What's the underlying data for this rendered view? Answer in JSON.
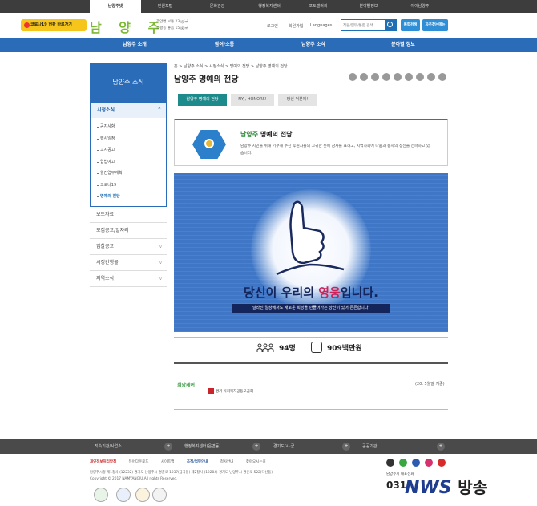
{
  "topbar": {
    "tabs": [
      "남양주넷",
      "민원포털",
      "문화관광",
      "행정복지센터",
      "포토갤러리",
      "분야별정보",
      "아이남양주"
    ]
  },
  "header": {
    "covid_label": "코로나19 현황 바로가기",
    "logo": "남 양 주",
    "weather_line1": "조안면 보통 23㎍/㎥",
    "weather_line2": "호평동 좋음 15㎍/㎥",
    "login": "로그인",
    "join": "회원가입",
    "languages": "Languages",
    "search_placeholder": "직원/업무/통합 검색",
    "btn_integrated": "통합검색",
    "btn_faq": "자주찾는메뉴"
  },
  "gnb": [
    "남양주 소개",
    "참여/소통",
    "남양주 소식",
    "분야별 정보"
  ],
  "lnb": {
    "head": "남양주 소식",
    "group_title": "시정소식",
    "sub_items": [
      "공지사항",
      "행사일정",
      "고시공고",
      "입법예고",
      "월간업무계획",
      "코로나19",
      "명예의 전당"
    ],
    "rows": [
      "보도자료",
      "모집공고/일자리",
      "입찰공고",
      "시정간행물",
      "지역소식"
    ]
  },
  "breadcrumb": "홈 > 남양주 소식 > 시정소식 > 명예의 전당 > 남양주 명예의 전당",
  "page_title": "남양주 명예의 전당",
  "tabs": [
    "남양주 명예의 전당",
    "NYJ, HONORS!",
    "당신 덕분에!"
  ],
  "info": {
    "title_accent": "남양주",
    "title_rest": " 명예의 전당",
    "text": "남양주 시민을 위해 기부해 주신 후원자들의 고귀한 뜻에 감사를 표하고, 지역사회에 나눔과 봉사의 정신을 전파하고 있습니다."
  },
  "banner": {
    "headline_a": "당신이 우리의 ",
    "headline_b": "영웅",
    "headline_c": "입니다.",
    "sub": "달라진 일상에서도 새로운 희망을 만들어가는 당신이 있어 든든합니다."
  },
  "stats": {
    "people": "94명",
    "amount": "909백만원"
  },
  "basis": "(20. 5월말 기준)",
  "partners": {
    "p1": "희망케어",
    "p2": "경기 사회복지공동모금회"
  },
  "footer": {
    "bar": [
      "직속기관/사업소",
      "행정복지센터(읍면동)",
      "경기도/시·군",
      "공공기관"
    ],
    "links": [
      "개인정보처리방침",
      "뷰어다운로드",
      "사이트맵",
      "조직/업무안내",
      "청사안내",
      "찾아오시는길"
    ],
    "addr1": "남양주시청 제1청사 (12232) 경기도 남양주시 경춘로 1037(금곡동) 제2청사 (12284) 경기도 남양주시 경춘로 522(다산동)",
    "addr2": "Copyright © 2017 NAMYANGJU.All rights Reserved.",
    "tel_label": "남양주시 대표전화",
    "tel": "031-"
  },
  "watermark": {
    "a": "NWS",
    "b": "방송"
  },
  "colors": {
    "brand_blue": "#2a6cb8",
    "tab_teal": "#1d8a8c",
    "logo_green": "#7cb833"
  }
}
